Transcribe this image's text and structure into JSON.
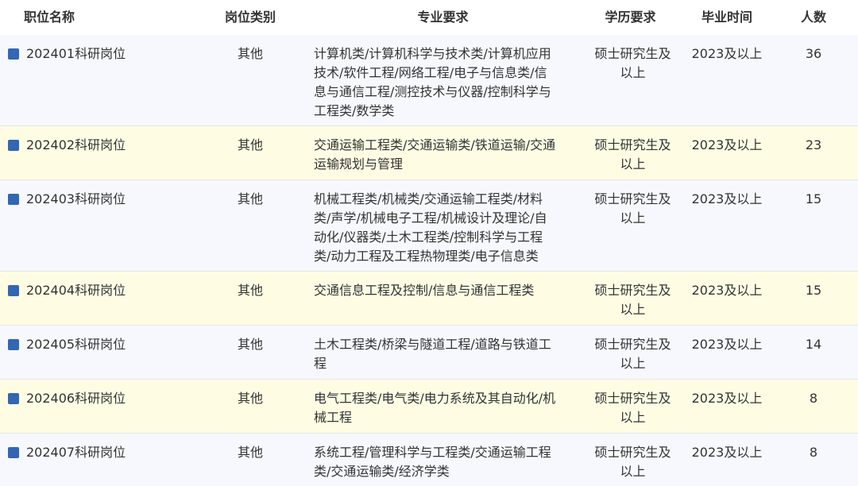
{
  "colors": {
    "row_odd": "#f6f8fd",
    "row_even": "#fefde4",
    "marker": "#3366b3",
    "header_bg": "#ffffff"
  },
  "header": {
    "position_name": "职位名称",
    "position_type": "岗位类别",
    "major": "专业要求",
    "education": "学历要求",
    "graduation": "毕业时间",
    "count": "人数"
  },
  "rows": [
    {
      "name": "202401科研岗位",
      "type": "其他",
      "major": "计算机类/计算机科学与技术类/计算机应用技术/软件工程/网络工程/电子与信息类/信息与通信工程/测控技术与仪器/控制科学与工程类/数学类",
      "education": "硕士研究生及以上",
      "graduation": "2023及以上",
      "count": "36"
    },
    {
      "name": "202402科研岗位",
      "type": "其他",
      "major": "交通运输工程类/交通运输类/铁道运输/交通运输规划与管理",
      "education": "硕士研究生及以上",
      "graduation": "2023及以上",
      "count": "23"
    },
    {
      "name": "202403科研岗位",
      "type": "其他",
      "major": "机械工程类/机械类/交通运输工程类/材料类/声学/机械电子工程/机械设计及理论/自动化/仪器类/土木工程类/控制科学与工程类/动力工程及工程热物理类/电子信息类",
      "education": "硕士研究生及以上",
      "graduation": "2023及以上",
      "count": "15"
    },
    {
      "name": "202404科研岗位",
      "type": "其他",
      "major": "交通信息工程及控制/信息与通信工程类",
      "education": "硕士研究生及以上",
      "graduation": "2023及以上",
      "count": "15"
    },
    {
      "name": "202405科研岗位",
      "type": "其他",
      "major": "土木工程类/桥梁与隧道工程/道路与铁道工程",
      "education": "硕士研究生及以上",
      "graduation": "2023及以上",
      "count": "14"
    },
    {
      "name": "202406科研岗位",
      "type": "其他",
      "major": "电气工程类/电气类/电力系统及其自动化/机械工程",
      "education": "硕士研究生及以上",
      "graduation": "2023及以上",
      "count": "8"
    },
    {
      "name": "202407科研岗位",
      "type": "其他",
      "major": "系统工程/管理科学与工程类/交通运输工程类/交通运输类/经济学类",
      "education": "硕士研究生及以上",
      "graduation": "2023及以上",
      "count": "8"
    }
  ]
}
